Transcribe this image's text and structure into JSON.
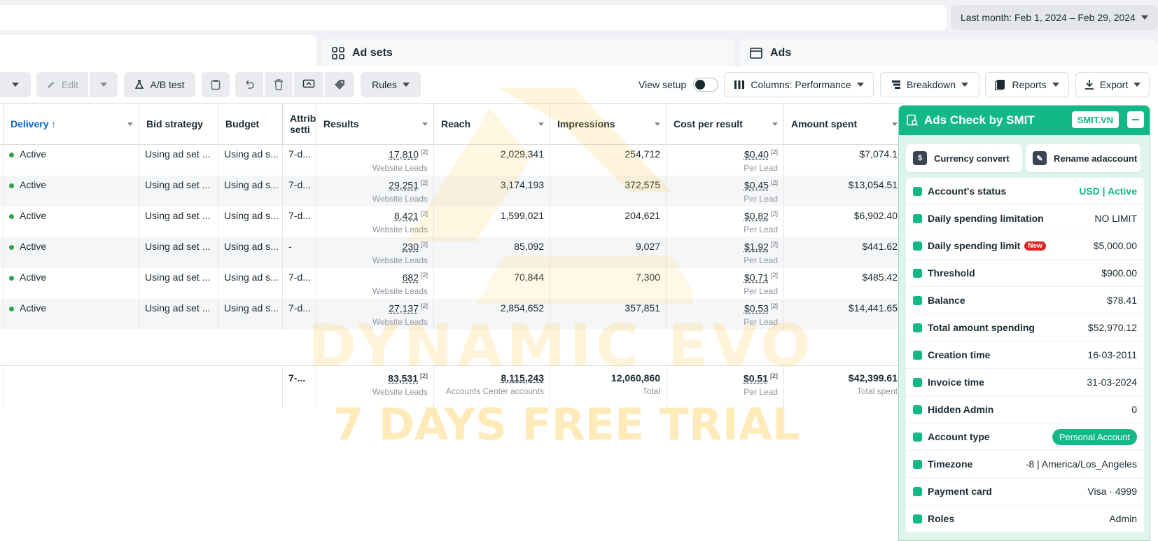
{
  "header": {
    "date_range": "Last month: Feb 1, 2024 – Feb 29, 2024"
  },
  "tabs": {
    "adsets": "Ad sets",
    "ads": "Ads"
  },
  "toolbar": {
    "edit": "Edit",
    "ab_test": "A/B test",
    "rules": "Rules",
    "view_setup": "View setup",
    "columns": "Columns: Performance",
    "breakdown": "Breakdown",
    "reports": "Reports",
    "export": "Export"
  },
  "table": {
    "headers": {
      "delivery": "Delivery ↑",
      "bid_strategy": "Bid strategy",
      "budget": "Budget",
      "attribution": "Attrib setti",
      "results": "Results",
      "reach": "Reach",
      "impressions": "Impressions",
      "cost_per_result": "Cost per result",
      "amount_spent": "Amount spent"
    },
    "rows": [
      {
        "delivery": "Active",
        "bid": "Using ad set ...",
        "budget": "Using ad s...",
        "attr": "7-d...",
        "results": "17,810",
        "results_sub": "Website Leads",
        "reach": "2,029,341",
        "impressions": "254,712",
        "cpr": "$0.40",
        "cpr_sub": "Per Lead",
        "spent": "$7,074.1"
      },
      {
        "delivery": "Active",
        "bid": "Using ad set ...",
        "budget": "Using ad s...",
        "attr": "7-d...",
        "results": "29,251",
        "results_sub": "Website Leads",
        "reach": "3,174,193",
        "impressions": "372,575",
        "cpr": "$0.45",
        "cpr_sub": "Per Lead",
        "spent": "$13,054.51"
      },
      {
        "delivery": "Active",
        "bid": "Using ad set ...",
        "budget": "Using ad s...",
        "attr": "7-d...",
        "results": "8,421",
        "results_sub": "Website Leads",
        "reach": "1,599,021",
        "impressions": "204,621",
        "cpr": "$0.82",
        "cpr_sub": "Per Lead",
        "spent": "$6,902.40"
      },
      {
        "delivery": "Active",
        "bid": "Using ad set ...",
        "budget": "Using ad s...",
        "attr": "-",
        "results": "230",
        "results_sub": "Website Leads",
        "reach": "85,092",
        "impressions": "9,027",
        "cpr": "$1.92",
        "cpr_sub": "Per Lead",
        "spent": "$441.62"
      },
      {
        "delivery": "Active",
        "bid": "Using ad set ...",
        "budget": "Using ad s...",
        "attr": "7-d...",
        "results": "682",
        "results_sub": "Website Leads",
        "reach": "70,844",
        "impressions": "7,300",
        "cpr": "$0.71",
        "cpr_sub": "Per Lead",
        "spent": "$485.42"
      },
      {
        "delivery": "Active",
        "bid": "Using ad set ...",
        "budget": "Using ad s...",
        "attr": "7-d...",
        "results": "27,137",
        "results_sub": "Website Leads",
        "reach": "2,854,652",
        "impressions": "357,851",
        "cpr": "$0.53",
        "cpr_sub": "Per Lead",
        "spent": "$14,441.65"
      }
    ],
    "totals": {
      "attr": "7-...",
      "results": "83,531",
      "results_sub": "Website Leads",
      "reach": "8,115,243",
      "reach_sub": "Accounts Center accounts",
      "impressions": "12,060,860",
      "impressions_sub": "Total",
      "cpr": "$0.51",
      "cpr_sub": "Per Lead",
      "spent": "$42,399.61",
      "spent_sub": "Total spent"
    },
    "footnote": "[2]"
  },
  "watermark": {
    "line1": "DYNAMIC EVO",
    "line2": "7 DAYS FREE TRIAL"
  },
  "smit": {
    "title": "Ads Check by SMIT",
    "tag": "SMIT.VN",
    "currency_convert": "Currency convert",
    "rename": "Rename adaccount",
    "new_badge": "New",
    "rows": [
      {
        "label": "Account's status",
        "value": "USD | Active"
      },
      {
        "label": "Daily spending limitation",
        "value": "NO LIMIT"
      },
      {
        "label": "Daily spending limit",
        "value": "$5,000.00"
      },
      {
        "label": "Threshold",
        "value": "$900.00"
      },
      {
        "label": "Balance",
        "value": "$78.41"
      },
      {
        "label": "Total amount spending",
        "value": "$52,970.12"
      },
      {
        "label": "Creation time",
        "value": "16-03-2011"
      },
      {
        "label": "Invoice time",
        "value": "31-03-2024"
      },
      {
        "label": "Hidden Admin",
        "value": "0"
      },
      {
        "label": "Account type",
        "value": "Personal Account"
      },
      {
        "label": "Timezone",
        "value": "-8 | America/Los_Angeles"
      },
      {
        "label": "Payment card",
        "value": "Visa · 4999"
      },
      {
        "label": "Roles",
        "value": "Admin"
      }
    ]
  },
  "colors": {
    "accent": "#12b886",
    "link": "#0a66c2",
    "active_dot": "#31a24c"
  }
}
